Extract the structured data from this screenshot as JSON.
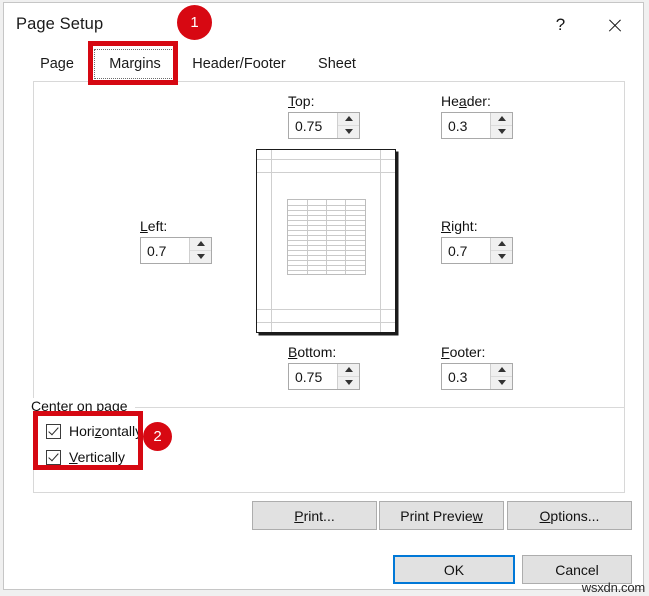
{
  "window": {
    "title": "Page Setup",
    "help_label": "?",
    "close_label": "✕",
    "help_icon": "question-mark-icon",
    "close_icon": "close-x-icon"
  },
  "tabs": [
    {
      "label": "Page",
      "selected": false
    },
    {
      "label": "Margins",
      "selected": true
    },
    {
      "label": "Header/Footer",
      "selected": false
    },
    {
      "label": "Sheet",
      "selected": false
    }
  ],
  "margins": {
    "top": {
      "label_pre": "",
      "label_accel": "T",
      "label_post": "op:",
      "value": "0.75"
    },
    "header": {
      "label_pre": "He",
      "label_accel": "a",
      "label_post": "der:",
      "value": "0.3"
    },
    "left": {
      "label_pre": "",
      "label_accel": "L",
      "label_post": "eft:",
      "value": "0.7"
    },
    "right": {
      "label_pre": "",
      "label_accel": "R",
      "label_post": "ight:",
      "value": "0.7"
    },
    "bottom": {
      "label_pre": "",
      "label_accel": "B",
      "label_post": "ottom:",
      "value": "0.75"
    },
    "footer": {
      "label_pre": "",
      "label_accel": "F",
      "label_post": "ooter:",
      "value": "0.3"
    }
  },
  "center_on_page": {
    "group_label": "Center on page",
    "horizontally": {
      "label_pre": "Hori",
      "label_accel": "z",
      "label_post": "ontally",
      "checked": true
    },
    "vertically": {
      "label_pre": "",
      "label_accel": "V",
      "label_post": "ertically",
      "checked": true
    }
  },
  "buttons": {
    "print": {
      "label_pre": "",
      "label_accel": "P",
      "label_post": "rint..."
    },
    "print_preview": {
      "label_pre": "Print Previe",
      "label_accel": "w",
      "label_post": ""
    },
    "options": {
      "label_pre": "",
      "label_accel": "O",
      "label_post": "ptions..."
    },
    "ok": {
      "label": "OK"
    },
    "cancel": {
      "label": "Cancel"
    }
  },
  "annotations": [
    {
      "id": "1",
      "label": "1"
    },
    {
      "id": "2",
      "label": "2"
    }
  ],
  "watermark": {
    "text": "wsxdn.com"
  },
  "colors": {
    "annotation_red": "#d70812",
    "focus_blue": "#0078d7",
    "button_face": "#e1e1e1"
  }
}
